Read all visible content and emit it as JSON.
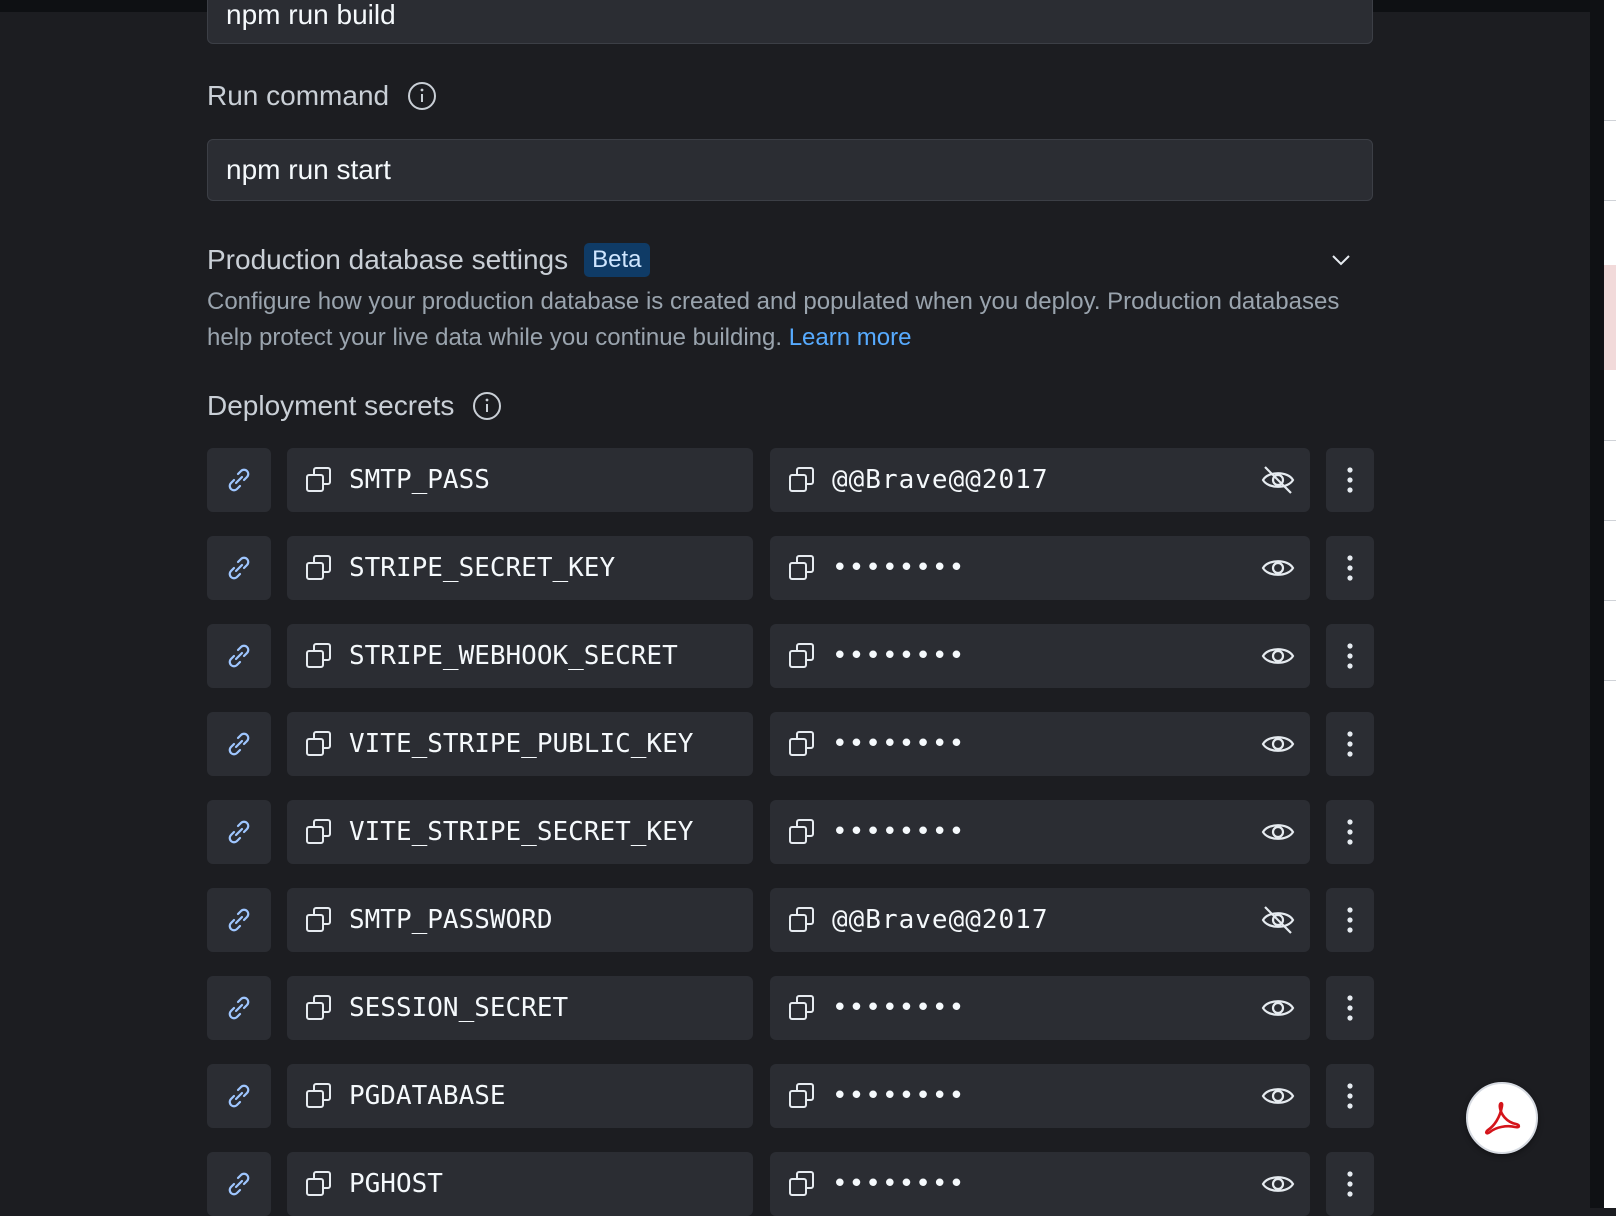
{
  "build": {
    "value": "npm run build"
  },
  "run": {
    "label": "Run command",
    "value": "npm run start"
  },
  "database": {
    "title": "Production database settings",
    "badge": "Beta",
    "description": "Configure how your production database is created and populated when you deploy. Production databases help protect your live data while you continue building.",
    "learn_more": "Learn more"
  },
  "secrets": {
    "label": "Deployment secrets",
    "items": [
      {
        "key": "SMTP_PASS",
        "value": "@@Brave@@2017",
        "visible": true
      },
      {
        "key": "STRIPE_SECRET_KEY",
        "value": "••••••••",
        "visible": false
      },
      {
        "key": "STRIPE_WEBHOOK_SECRET",
        "value": "••••••••",
        "visible": false
      },
      {
        "key": "VITE_STRIPE_PUBLIC_KEY",
        "value": "••••••••",
        "visible": false
      },
      {
        "key": "VITE_STRIPE_SECRET_KEY",
        "value": "••••••••",
        "visible": false
      },
      {
        "key": "SMTP_PASSWORD",
        "value": "@@Brave@@2017",
        "visible": true
      },
      {
        "key": "SESSION_SECRET",
        "value": "••••••••",
        "visible": false
      },
      {
        "key": "PGDATABASE",
        "value": "••••••••",
        "visible": false
      },
      {
        "key": "PGHOST",
        "value": "••••••••",
        "visible": false
      }
    ]
  },
  "icons": {
    "info": "info-icon",
    "chevron": "chevron-down-icon",
    "link": "link-icon",
    "copy": "copy-icon",
    "eye": "eye-icon",
    "eye_off": "eye-off-icon",
    "more": "more-vertical-icon",
    "pdf": "acrobat-icon"
  },
  "colors": {
    "background": "#1c1d21",
    "field": "#2b2d33",
    "link": "#57abff",
    "badge_bg": "#0f3b66"
  }
}
